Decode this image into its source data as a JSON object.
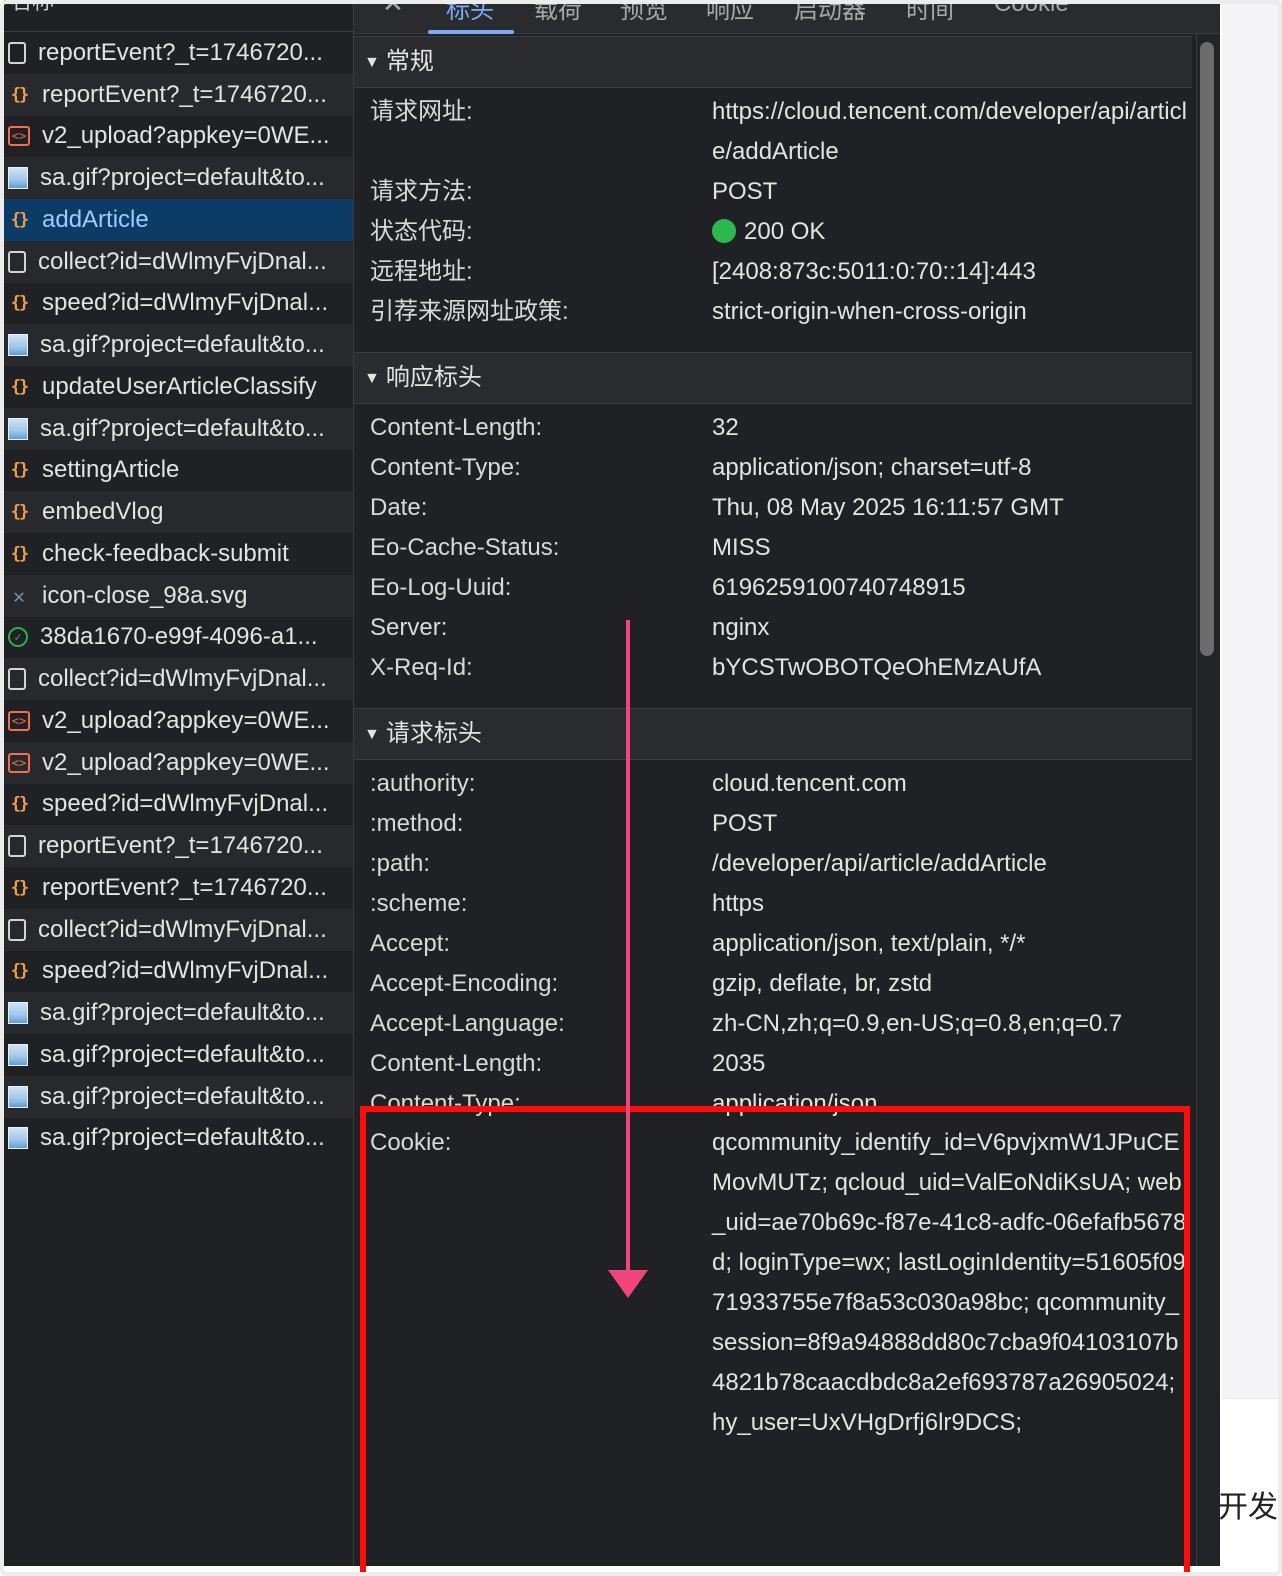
{
  "list": {
    "header": "名称",
    "rows": [
      {
        "icon": "document-icon",
        "name": "reportEvent?_t=1746720...",
        "selected": false
      },
      {
        "icon": "json-icon",
        "name": "reportEvent?_t=1746720...",
        "selected": false
      },
      {
        "icon": "script-icon",
        "name": "v2_upload?appkey=0WE...",
        "selected": false
      },
      {
        "icon": "image-icon",
        "name": "sa.gif?project=default&to...",
        "selected": false
      },
      {
        "icon": "json-icon",
        "name": "addArticle",
        "selected": true
      },
      {
        "icon": "document-icon",
        "name": "collect?id=dWlmyFvjDnal...",
        "selected": false
      },
      {
        "icon": "json-icon",
        "name": "speed?id=dWlmyFvjDnal...",
        "selected": false
      },
      {
        "icon": "image-icon",
        "name": "sa.gif?project=default&to...",
        "selected": false
      },
      {
        "icon": "json-icon",
        "name": "updateUserArticleClassify",
        "selected": false
      },
      {
        "icon": "image-icon",
        "name": "sa.gif?project=default&to...",
        "selected": false
      },
      {
        "icon": "json-icon",
        "name": "settingArticle",
        "selected": false
      },
      {
        "icon": "json-icon",
        "name": "embedVlog",
        "selected": false
      },
      {
        "icon": "json-icon",
        "name": "check-feedback-submit",
        "selected": false
      },
      {
        "icon": "svg-close-icon",
        "name": "icon-close_98a.svg",
        "selected": false
      },
      {
        "icon": "check-circle-icon",
        "name": "38da1670-e99f-4096-a1...",
        "selected": false
      },
      {
        "icon": "document-icon",
        "name": "collect?id=dWlmyFvjDnal...",
        "selected": false
      },
      {
        "icon": "script-icon",
        "name": "v2_upload?appkey=0WE...",
        "selected": false
      },
      {
        "icon": "script-icon",
        "name": "v2_upload?appkey=0WE...",
        "selected": false
      },
      {
        "icon": "json-icon",
        "name": "speed?id=dWlmyFvjDnal...",
        "selected": false
      },
      {
        "icon": "document-icon",
        "name": "reportEvent?_t=1746720...",
        "selected": false
      },
      {
        "icon": "json-icon",
        "name": "reportEvent?_t=1746720...",
        "selected": false
      },
      {
        "icon": "document-icon",
        "name": "collect?id=dWlmyFvjDnal...",
        "selected": false
      },
      {
        "icon": "json-icon",
        "name": "speed?id=dWlmyFvjDnal...",
        "selected": false
      },
      {
        "icon": "image-icon",
        "name": "sa.gif?project=default&to...",
        "selected": false
      },
      {
        "icon": "image-icon",
        "name": "sa.gif?project=default&to...",
        "selected": false
      },
      {
        "icon": "image-icon",
        "name": "sa.gif?project=default&to...",
        "selected": false
      },
      {
        "icon": "image-icon",
        "name": "sa.gif?project=default&to...",
        "selected": false
      }
    ]
  },
  "tabs": {
    "close": "✕",
    "items": [
      "标头",
      "载荷",
      "预览",
      "响应",
      "启动器",
      "时间",
      "Cookie"
    ],
    "active": "标头"
  },
  "general": {
    "title": "常规",
    "rows": [
      {
        "key": "请求网址:",
        "value": "https://cloud.tencent.com/developer/api/article/addArticle"
      },
      {
        "key": "请求方法:",
        "value": "POST"
      },
      {
        "key": "状态代码:",
        "value": "200 OK",
        "status_color": "#2db84d"
      },
      {
        "key": "远程地址:",
        "value": "[2408:873c:5011:0:70::14]:443"
      },
      {
        "key": "引荐来源网址政策:",
        "value": "strict-origin-when-cross-origin"
      }
    ]
  },
  "response_headers": {
    "title": "响应标头",
    "rows": [
      {
        "key": "Content-Length:",
        "value": "32"
      },
      {
        "key": "Content-Type:",
        "value": "application/json; charset=utf-8"
      },
      {
        "key": "Date:",
        "value": "Thu, 08 May 2025 16:11:57 GMT"
      },
      {
        "key": "Eo-Cache-Status:",
        "value": "MISS"
      },
      {
        "key": "Eo-Log-Uuid:",
        "value": "6196259100740748915"
      },
      {
        "key": "Server:",
        "value": "nginx"
      },
      {
        "key": "X-Req-Id:",
        "value": "bYCSTwOBOTQeOhEMzAUfA"
      }
    ]
  },
  "request_headers": {
    "title": "请求标头",
    "rows": [
      {
        "key": ":authority:",
        "value": "cloud.tencent.com"
      },
      {
        "key": ":method:",
        "value": "POST"
      },
      {
        "key": ":path:",
        "value": "/developer/api/article/addArticle"
      },
      {
        "key": ":scheme:",
        "value": "https"
      },
      {
        "key": "Accept:",
        "value": "application/json, text/plain, */*"
      },
      {
        "key": "Accept-Encoding:",
        "value": "gzip, deflate, br, zstd"
      },
      {
        "key": "Accept-Language:",
        "value": "zh-CN,zh;q=0.9,en-US;q=0.8,en;q=0.7"
      },
      {
        "key": "Content-Length:",
        "value": "2035"
      },
      {
        "key": "Content-Type:",
        "value": "application/json"
      },
      {
        "key": "Cookie:",
        "value": "qcommunity_identify_id=V6pvjxmW1JPuCEMovMUTz; qcloud_uid=ValEoNdiKsUA; web_uid=ae70b69c-f87e-41c8-adfc-06efafb5678d; loginType=wx; lastLoginIdentity=51605f0971933755e7f8a53c030a98bc; qcommunity_session=8f9a94888dd80c7cba9f04103107b4821b78caacdbdc8a2ef693787a26905024; hy_user=UxVHgDrfj6lr9DCS;"
      }
    ]
  },
  "page_partial_text": "开发者",
  "colors": {
    "panel_bg": "#202124",
    "selected_row_bg": "#0c3c66",
    "active_tab": "#7cacf8",
    "annotation_box": "#ff0d0d",
    "annotation_arrow": "#f0457d",
    "status_ok": "#2db84d"
  }
}
